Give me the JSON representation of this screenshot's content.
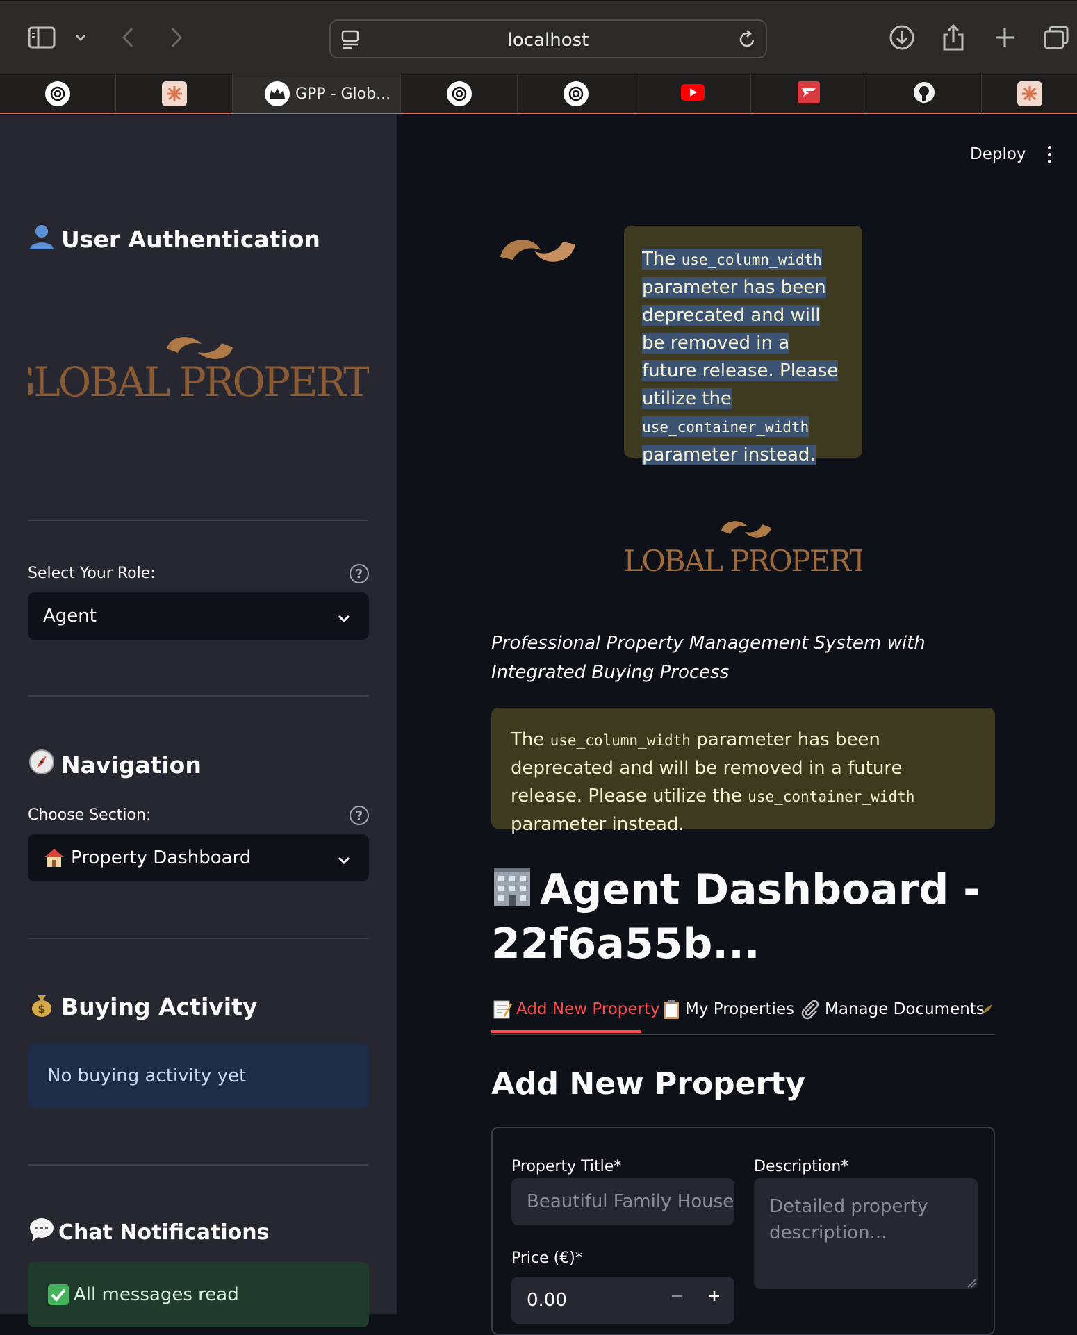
{
  "browser": {
    "url": "localhost",
    "tabs": [
      {
        "icon": "openai-icon"
      },
      {
        "icon": "claude-icon"
      },
      {
        "icon": "crown-icon",
        "title": "GPP - Glob..."
      },
      {
        "icon": "openai-icon"
      },
      {
        "icon": "openai-icon"
      },
      {
        "icon": "youtube-icon"
      },
      {
        "icon": "expressvpn-icon"
      },
      {
        "icon": "github-icon"
      },
      {
        "icon": "claude-icon"
      }
    ]
  },
  "header": {
    "deploy_label": "Deploy"
  },
  "sidebar": {
    "auth_title": "User Authentication",
    "logo_text": "GLOBAL PROPERTY",
    "role_label": "Select Your Role:",
    "role_value": "Agent",
    "nav_title": "Navigation",
    "section_label": "Choose Section:",
    "section_value": "Property Dashboard",
    "buying_title": "Buying Activity",
    "buying_info": "No buying activity yet",
    "chat_title": "Chat Notifications",
    "chat_status": "All messages read"
  },
  "main": {
    "warning_small": {
      "p1": "The ",
      "code1": "use_column_width",
      "p2": " parameter has been deprecated and will be removed in a future release. Please utilize the ",
      "code2": "use_container_width",
      "p3": " parameter instead."
    },
    "logo_text": "GLOBAL PROPERTY",
    "tagline": "Professional Property Management System with Integrated Buying Process",
    "warning_big": {
      "p1": "The ",
      "code1": "use_column_width",
      "p2": " parameter has been deprecated and will be removed in a future release. Please utilize the ",
      "code2": "use_container_width",
      "p3": " parameter instead."
    },
    "title": "Agent Dashboard - 22f6a55b...",
    "tabs": [
      {
        "label": "Add New Property",
        "active": true
      },
      {
        "label": "My Properties"
      },
      {
        "label": "Manage Documents"
      }
    ],
    "section_title": "Add New Property",
    "form": {
      "title_label": "Property Title*",
      "title_placeholder": "Beautiful Family House",
      "desc_label": "Description*",
      "desc_placeholder": "Detailed property description...",
      "price_label": "Price (€)*",
      "price_value": "0.00"
    }
  },
  "colors": {
    "accent": "#ff4b4b",
    "logo_gold": "#b07a48",
    "warning_bg": "#3d3a1f"
  }
}
